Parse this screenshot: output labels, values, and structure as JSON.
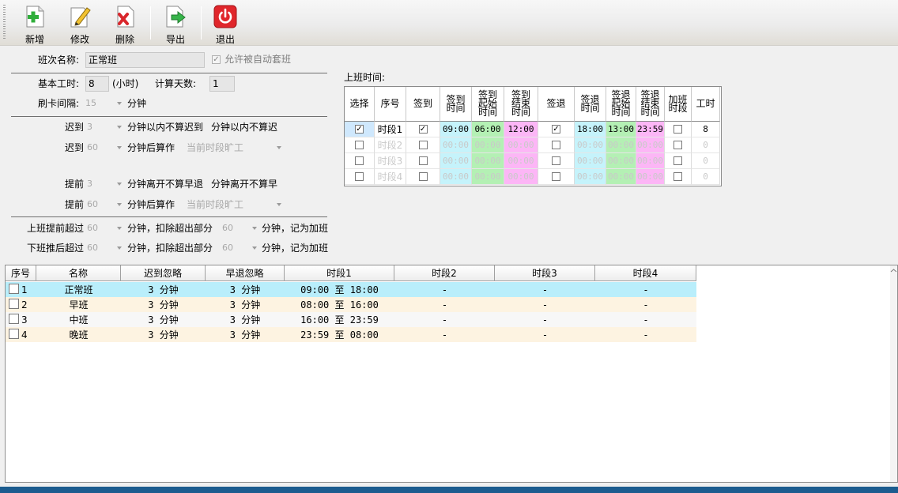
{
  "toolbar": {
    "buttons": [
      {
        "label": "新增"
      },
      {
        "label": "修改"
      },
      {
        "label": "删除"
      },
      {
        "label": "导出"
      },
      {
        "label": "退出"
      }
    ]
  },
  "form": {
    "shift_name_label": "班次名称:",
    "shift_name_value": "正常班",
    "auto_shift_label": "允许被自动套班",
    "work_hours_label": "基本工时:",
    "work_hours_value": "8",
    "work_hours_unit": "(小时)",
    "calc_days_label": "计算天数:",
    "calc_days_value": "1",
    "card_interval_label": "刷卡间隔:",
    "card_interval_value": "15",
    "card_interval_unit": "分钟",
    "late1_label": "迟到",
    "late1_value": "3",
    "late1_text": "分钟以内不算迟到",
    "late1_text2": "分钟以内不算迟",
    "late2_label": "迟到",
    "late2_value": "60",
    "late2_text": "分钟后算作",
    "late2_select": "当前时段旷工",
    "early1_label": "提前",
    "early1_value": "3",
    "early1_text": "分钟离开不算早退",
    "early1_text2": "分钟离开不算早",
    "early2_label": "提前",
    "early2_value": "60",
    "early2_text": "分钟后算作",
    "early2_select": "当前时段旷工",
    "ot_early_label": "上班提前超过",
    "ot_early_value": "60",
    "ot_early_text": "分钟，扣除超出部分",
    "ot_early_value2": "60",
    "ot_early_text2": "分钟，记为加班",
    "ot_late_label": "下班推后超过",
    "ot_late_value": "60",
    "ot_late_text": "分钟，扣除超出部分",
    "ot_late_value2": "60",
    "ot_late_text2": "分钟，记为加班"
  },
  "timetable": {
    "title": "上班时间:",
    "headers": [
      "选择",
      "序号",
      "签到",
      "签到\n时间",
      "签到\n起始\n时间",
      "签到\n结束\n时间",
      "签退",
      "签退\n时间",
      "签退\n起始\n时间",
      "签退\n结束\n时间",
      "加班\n时段",
      "工时"
    ],
    "rows": [
      {
        "select": true,
        "name": "时段1",
        "checkin": true,
        "in_time": "09:00",
        "in_start": "06:00",
        "in_end": "12:00",
        "checkout": true,
        "out_time": "18:00",
        "out_start": "13:00",
        "out_end": "23:59",
        "overtime": false,
        "hours": "8",
        "active": true
      },
      {
        "select": false,
        "name": "时段2",
        "checkin": false,
        "in_time": "00:00",
        "in_start": "00:00",
        "in_end": "00:00",
        "checkout": false,
        "out_time": "00:00",
        "out_start": "00:00",
        "out_end": "00:00",
        "overtime": false,
        "hours": "0",
        "active": false
      },
      {
        "select": false,
        "name": "时段3",
        "checkin": false,
        "in_time": "00:00",
        "in_start": "00:00",
        "in_end": "00:00",
        "checkout": false,
        "out_time": "00:00",
        "out_start": "00:00",
        "out_end": "00:00",
        "overtime": false,
        "hours": "0",
        "active": false
      },
      {
        "select": false,
        "name": "时段4",
        "checkin": false,
        "in_time": "00:00",
        "in_start": "00:00",
        "in_end": "00:00",
        "checkout": false,
        "out_time": "00:00",
        "out_start": "00:00",
        "out_end": "00:00",
        "overtime": false,
        "hours": "0",
        "active": false
      }
    ]
  },
  "grid": {
    "headers": [
      "序号",
      "名称",
      "迟到忽略",
      "早退忽略",
      "时段1",
      "时段2",
      "时段3",
      "时段4"
    ],
    "rows": [
      {
        "no": "1",
        "name": "正常班",
        "late": "3 分钟",
        "early": "3 分钟",
        "p1": "09:00 至 18:00",
        "p2": "-",
        "p3": "-",
        "p4": "-",
        "bg": "#b9eefb"
      },
      {
        "no": "2",
        "name": "早班",
        "late": "3 分钟",
        "early": "3 分钟",
        "p1": "08:00 至 16:00",
        "p2": "-",
        "p3": "-",
        "p4": "-",
        "bg": "#fdf3e1"
      },
      {
        "no": "3",
        "name": "中班",
        "late": "3 分钟",
        "early": "3 分钟",
        "p1": "16:00 至 23:59",
        "p2": "-",
        "p3": "-",
        "p4": "-",
        "bg": "#f7f7f7"
      },
      {
        "no": "4",
        "name": "晚班",
        "late": "3 分钟",
        "early": "3 分钟",
        "p1": "23:59 至 08:00",
        "p2": "-",
        "p3": "-",
        "p4": "-",
        "bg": "#fdf3e1"
      }
    ]
  },
  "colors": {
    "cyan": "#c5f3fb",
    "green": "#b4f0b4",
    "pink": "#fcb6f6",
    "status_bar": "#1c5c8f"
  }
}
